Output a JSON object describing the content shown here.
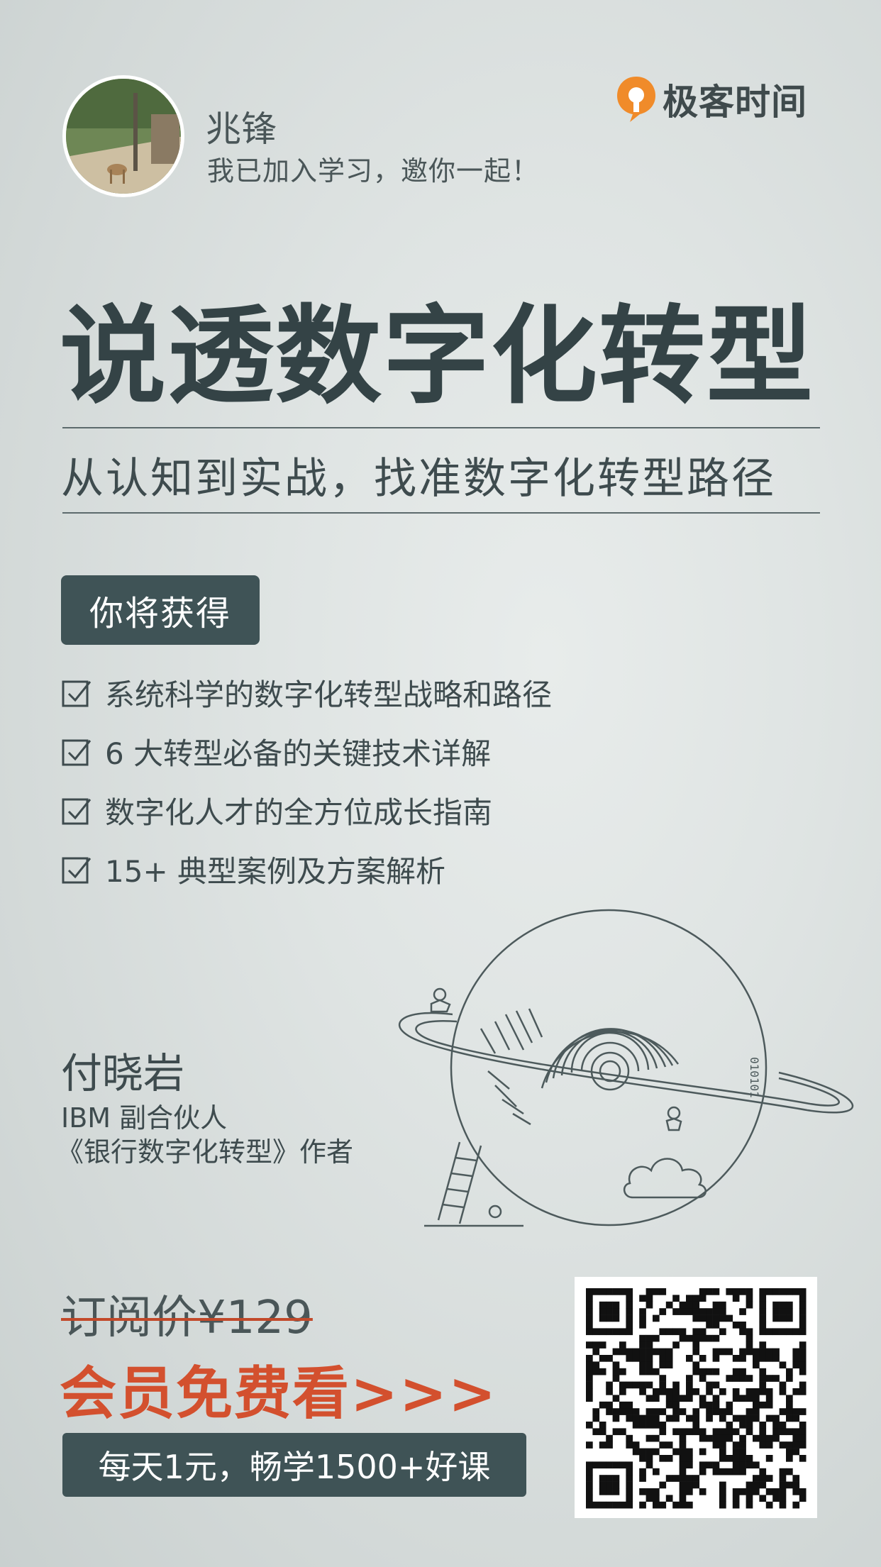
{
  "header": {
    "user_name": "兆锋",
    "invite_text": "我已加入学习，邀你一起！",
    "brand": "极客时间"
  },
  "course": {
    "title": "说透数字化转型",
    "subtitle": "从认知到实战，找准数字化转型路径"
  },
  "benefits": {
    "heading": "你将获得",
    "items": [
      "系统科学的数字化转型战略和路径",
      "6 大转型必备的关键技术详解",
      "数字化人才的全方位成长指南",
      "15+ 典型案例及方案解析"
    ]
  },
  "author": {
    "name": "付晓岩",
    "line1": "IBM 副合伙人",
    "line2": "《银行数字化转型》作者"
  },
  "illustration": {
    "binary_text": "010101"
  },
  "pricing": {
    "original": "订阅价¥129",
    "member_offer": "会员免费看>>>",
    "daily_promo": "每天1元，畅学1500+好课"
  },
  "colors": {
    "accent_orange": "#d3502e",
    "dark_teal": "#3f5356",
    "brand_orange": "#f08b2a"
  },
  "icons": [
    "brand-logo-icon",
    "checkbox-icon",
    "qr-code"
  ]
}
